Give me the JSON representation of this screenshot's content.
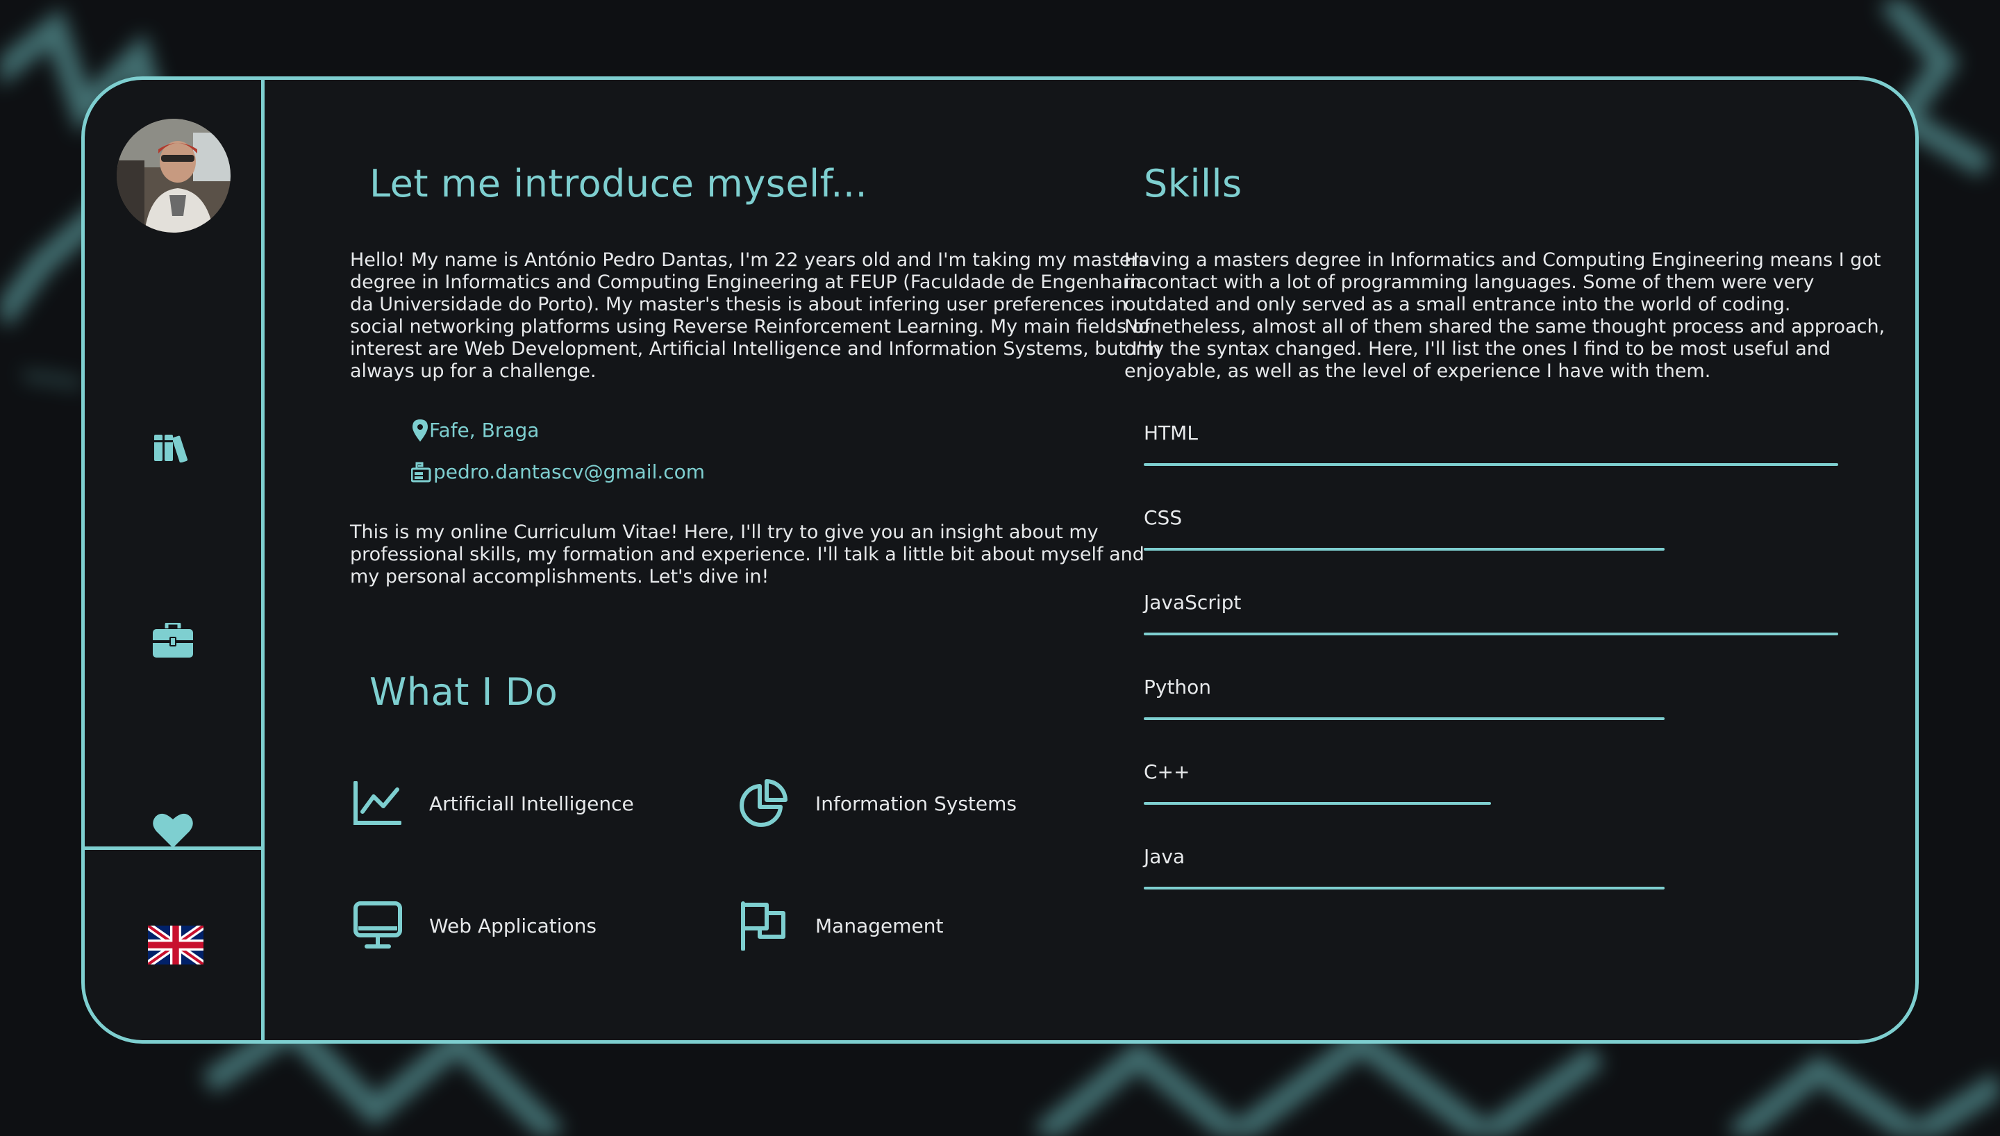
{
  "colors": {
    "accent": "#7ecfd0",
    "panel": "#131518",
    "background": "#0e1013",
    "text": "#e6e8ea"
  },
  "sidebar": {
    "avatar_icon": "profile-photo",
    "items": [
      {
        "icon": "books-icon"
      },
      {
        "icon": "briefcase-icon"
      },
      {
        "icon": "heart-icon"
      }
    ],
    "language_icon": "uk-flag-icon"
  },
  "intro": {
    "title": "Let me introduce myself...",
    "paragraph": "Hello! My name is António Pedro Dantas, I'm 22 years old and I'm taking my masters degree in Informatics and Computing Engineering at FEUP (Faculdade de Engenharia da Universidade do Porto). My master's thesis is about infering user preferences in social networking platforms using Reverse Reinforcement Learning. My main fields of interest are Web Development, Artificial Intelligence and Information Systems, but I'm always up for a challenge.",
    "location": "Fafe, Braga",
    "email": "pedro.dantascv@gmail.com",
    "paragraph2": "This is my online Curriculum Vitae! Here, I'll try to give you an insight about my professional skills, my formation and experience. I'll talk a little bit about myself and my personal accomplishments. Let's dive in!"
  },
  "what_i_do": {
    "title": "What I Do",
    "items": [
      {
        "label": "Artificiall Intelligence",
        "icon": "line-chart-icon"
      },
      {
        "label": "Information Systems",
        "icon": "pie-chart-icon"
      },
      {
        "label": "Web Applications",
        "icon": "monitor-icon"
      },
      {
        "label": "Management",
        "icon": "flag-icon"
      }
    ]
  },
  "skills": {
    "title": "Skills",
    "paragraph": "Having a masters degree in Informatics and Computing Engineering means I got in contact with a lot of programming languages. Some of them were very outdated and only served as a small entrance into the world of coding. Nonetheless, almost all of them shared the same thought process and approach, only the syntax changed. Here, I'll list the ones I find to be most useful and enjoyable, as well as the level of experience I have with them.",
    "items": [
      {
        "name": "HTML",
        "level": 1.0
      },
      {
        "name": "CSS",
        "level": 0.75
      },
      {
        "name": "JavaScript",
        "level": 1.0
      },
      {
        "name": "Python",
        "level": 0.75
      },
      {
        "name": "C++",
        "level": 0.5
      },
      {
        "name": "Java",
        "level": 0.75
      }
    ]
  }
}
